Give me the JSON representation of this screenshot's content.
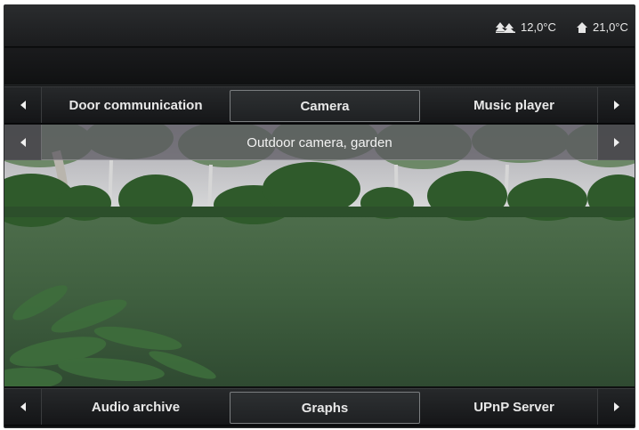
{
  "status": {
    "outdoor_temperature": "12,0°C",
    "indoor_temperature": "21,0°C",
    "outdoor_icon": "outdoor-trees-icon",
    "indoor_icon": "house-icon"
  },
  "top_tabs": {
    "items": [
      {
        "label": "Door communication",
        "active": false
      },
      {
        "label": "Camera",
        "active": true
      },
      {
        "label": "Music player",
        "active": false
      }
    ]
  },
  "camera": {
    "name": "Outdoor camera, garden"
  },
  "bottom_tabs": {
    "items": [
      {
        "label": "Audio archive",
        "active": false
      },
      {
        "label": "Graphs",
        "active": true
      },
      {
        "label": "UPnP Server",
        "active": false
      }
    ]
  },
  "colors": {
    "background": "#0f1011",
    "text": "#e8e8e8",
    "active_tab_border": "#7b7e80"
  }
}
